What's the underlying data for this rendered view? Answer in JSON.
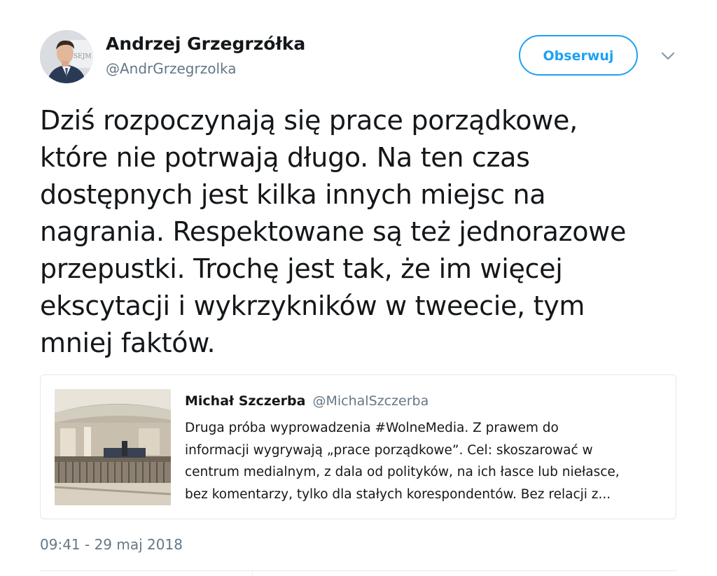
{
  "author": {
    "name": "Andrzej Grzegrzółka",
    "handle": "@AndrGrzegrzolka",
    "avatar_icon": "person-photo-icon"
  },
  "actions": {
    "follow_label": "Obserwuj",
    "menu_icon": "chevron-down-icon"
  },
  "tweet": {
    "lines": [
      "Dziś rozpoczynają się prace porządkowe,",
      "które nie potrwają długo. Na ten czas",
      "dostępnych jest kilka innych miejsc na",
      "nagrania. Respektowane są też jednorazowe",
      "przepustki. Trochę jest tak, że im więcej",
      "ekscytacji i wykrzykników w tweecie, tym",
      "mniej faktów."
    ],
    "timestamp": "09:41 - 29 maj 2018"
  },
  "quoted_tweet": {
    "name": "Michał Szczerba",
    "handle": "@MichalSzczerba",
    "image_icon": "chamber-photo-icon",
    "lines": [
      "Druga próba wyprowadzenia #WolneMedia. Z prawem do",
      "informacji wygrywają „prace porządkowe”. Cel: skoszarować w",
      "centrum medialnym, z dala od polityków, na ich łasce lub niełasce,",
      "bez komentarzy, tylko dla stałych korespondentów. Bez relacji z..."
    ]
  },
  "colors": {
    "accent": "#1da1f2",
    "text_primary": "#14171a",
    "text_secondary": "#657786",
    "border": "#e1e8ed"
  }
}
